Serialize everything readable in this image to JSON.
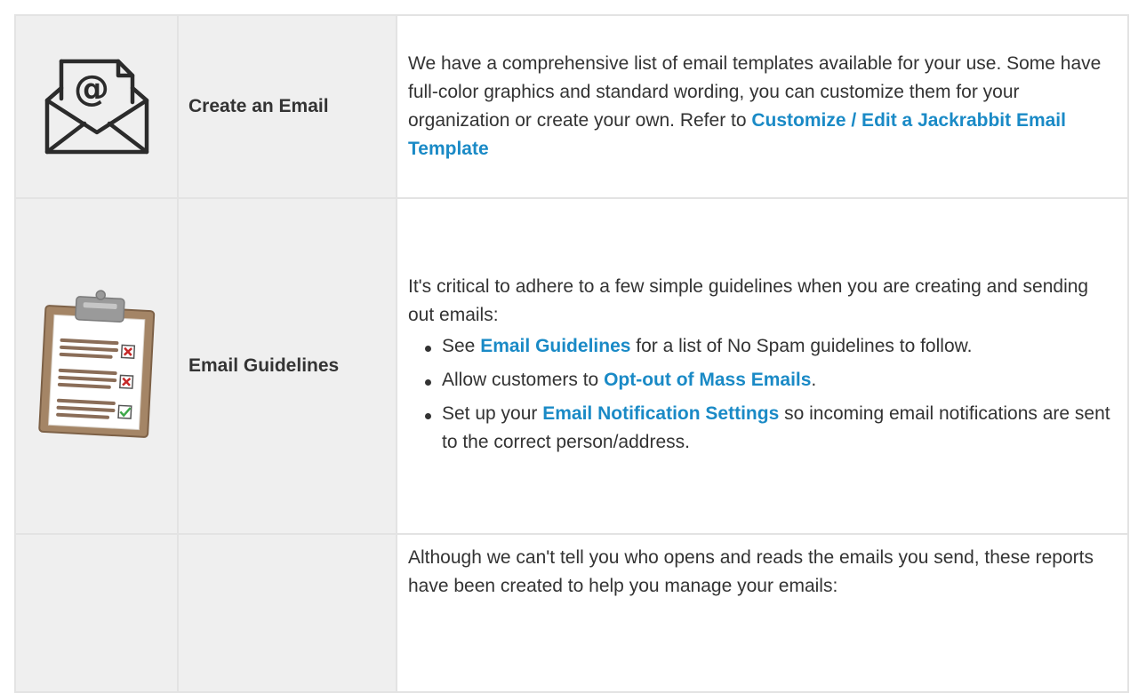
{
  "rows": [
    {
      "icon": "envelope-at-icon",
      "title": "Create an Email",
      "desc_text": "We have a comprehensive list of email templates available for your use. Some have full-color graphics and standard wording, you can customize them for your organization or create your own. Refer to ",
      "desc_link": "Customize / Edit a Jackrabbit Email Template"
    },
    {
      "icon": "clipboard-checklist-icon",
      "title": "Email Guidelines",
      "intro": "It's critical to adhere to a few simple guidelines when you are creating and sending out emails:",
      "bullets": [
        {
          "pre": "See ",
          "link": "Email Guidelines",
          "post": " for a list of No Spam guidelines to follow."
        },
        {
          "pre": "Allow customers to ",
          "link": "Opt-out of Mass Emails",
          "post": "."
        },
        {
          "pre": "Set up your ",
          "link": "Email Notification Settings",
          "post": " so incoming email notifications are sent to the correct person/address."
        }
      ]
    },
    {
      "intro": "Although we can't tell you who opens and reads the emails you send, these reports have been created to help you manage your emails:"
    }
  ],
  "colors": {
    "link": "#1a8ac6",
    "cell_bg": "#efefef",
    "border": "#e3e3e3",
    "text": "#333333"
  }
}
